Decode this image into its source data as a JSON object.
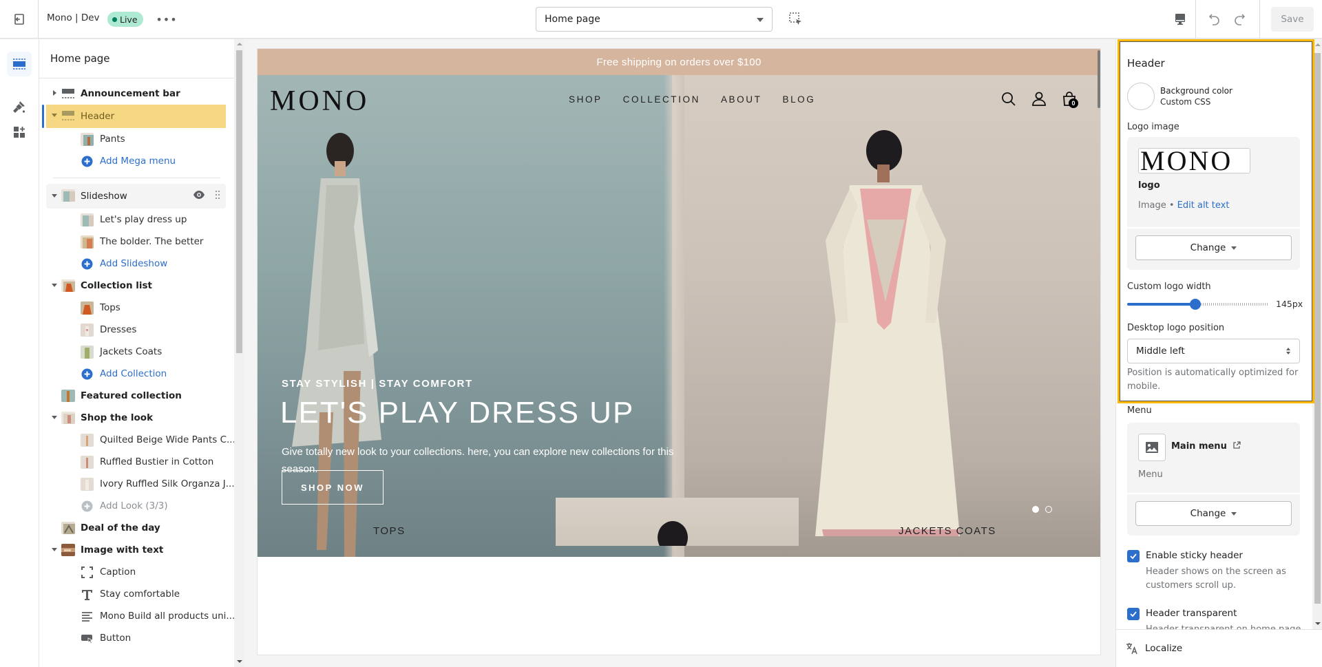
{
  "topbar": {
    "store_name": "Mono | Dev",
    "status_badge": "Live",
    "more_label": "•••",
    "page_selector": "Home page",
    "save_label": "Save"
  },
  "sidebar": {
    "title": "Home page",
    "sections": {
      "announcement": {
        "label": "Announcement bar"
      },
      "header": {
        "label": "Header",
        "blocks": [
          "Pants"
        ],
        "add_label": "Add Mega menu"
      },
      "slideshow": {
        "label": "Slideshow",
        "blocks": [
          "Let's play dress up",
          "The bolder. The better"
        ],
        "add_label": "Add Slideshow"
      },
      "collection_list": {
        "label": "Collection list",
        "blocks": [
          "Tops",
          "Dresses",
          "Jackets Coats"
        ],
        "add_label": "Add Collection"
      },
      "featured_collection": {
        "label": "Featured collection"
      },
      "shop_the_look": {
        "label": "Shop the look",
        "blocks": [
          "Quilted Beige Wide Pants C...",
          "Ruffled Bustier in Cotton",
          "Ivory Ruffled Silk Organza J..."
        ],
        "add_label": "Add Look (3/3)"
      },
      "deal_of_the_day": {
        "label": "Deal of the day"
      },
      "image_with_text": {
        "label": "Image with text",
        "blocks": [
          "Caption",
          "Stay comfortable",
          "Mono Build all products uni...",
          "Button"
        ]
      }
    }
  },
  "preview": {
    "announcement": "Free shipping on orders over $100",
    "logo": "MONO",
    "nav": [
      "SHOP",
      "COLLECTION",
      "ABOUT",
      "BLOG"
    ],
    "cart_count": "0",
    "hero": {
      "subheading": "STAY STYLISH | STAY COMFORT",
      "heading": "LET'S PLAY DRESS UP",
      "text": "Give totally new look to your collections. here, you can explore new collections for this season.",
      "button": "SHOP NOW",
      "slides_total": 2,
      "active_slide": 1
    },
    "collections": [
      "TOPS",
      "JACKETS COATS"
    ]
  },
  "settings": {
    "title": "Header",
    "background_color": {
      "label": "Background color",
      "sub": "Custom CSS",
      "value": "#ffffff"
    },
    "logo_image": {
      "label": "Logo image",
      "preview_text": "MONO",
      "name": "logo",
      "type": "Image",
      "separator": "•",
      "edit_alt": "Edit alt text",
      "change": "Change"
    },
    "logo_width": {
      "label": "Custom logo width",
      "value": 145,
      "unit": "px",
      "display": "145px",
      "fraction": 0.48
    },
    "logo_position": {
      "label": "Desktop logo position",
      "value": "Middle left",
      "help": "Position is automatically optimized for mobile."
    },
    "menu": {
      "label": "Menu",
      "name": "Main menu",
      "type": "Menu",
      "change": "Change"
    },
    "sticky_header": {
      "label": "Enable sticky header",
      "checked": true,
      "help": "Header shows on the screen as customers scroll up."
    },
    "header_transparent": {
      "label": "Header transparent",
      "checked": true,
      "help": "Header transparent on home page"
    },
    "localize": "Localize"
  },
  "colors": {
    "accent": "#2c6ecb",
    "selected_row": "#f6d883",
    "highlight_border": "#ffb800",
    "announcement_bg": "#d6b59f",
    "live_badge": "#aee9d1"
  }
}
